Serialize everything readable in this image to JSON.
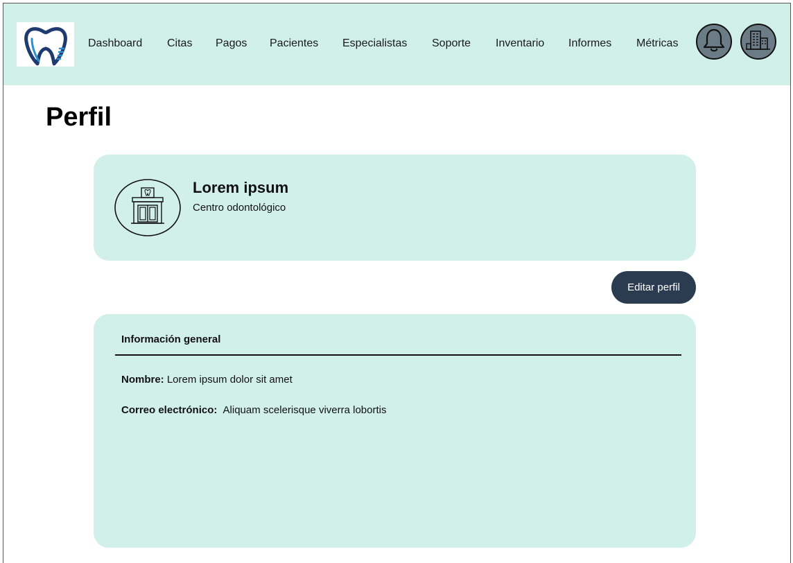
{
  "navbar": {
    "logo_icon": "tooth-logo-icon",
    "items": [
      {
        "label": "Dashboard"
      },
      {
        "label": "Citas"
      },
      {
        "label": "Pagos"
      },
      {
        "label": "Pacientes"
      },
      {
        "label": "Especialistas"
      },
      {
        "label": "Soporte"
      },
      {
        "label": "Inventario"
      },
      {
        "label": "Informes"
      },
      {
        "label": "Métricas"
      }
    ],
    "notification_icon": "bell-icon",
    "account_icon": "building-icon"
  },
  "page": {
    "title": "Perfil"
  },
  "profile": {
    "avatar_icon": "clinic-building-icon",
    "name": "Lorem ipsum",
    "subtitle": "Centro odontológico"
  },
  "actions": {
    "edit_label": "Editar perfil"
  },
  "info": {
    "heading": "Información general",
    "name_label": "Nombre:",
    "name_value": "Lorem ipsum dolor sit amet",
    "email_label": "Correo electrónico:",
    "email_value": "Aliquam scelerisque viverra lobortis"
  },
  "colors": {
    "panel": "#d1f0e9",
    "button": "#2b3c50",
    "circle_button": "#6b7c87"
  }
}
